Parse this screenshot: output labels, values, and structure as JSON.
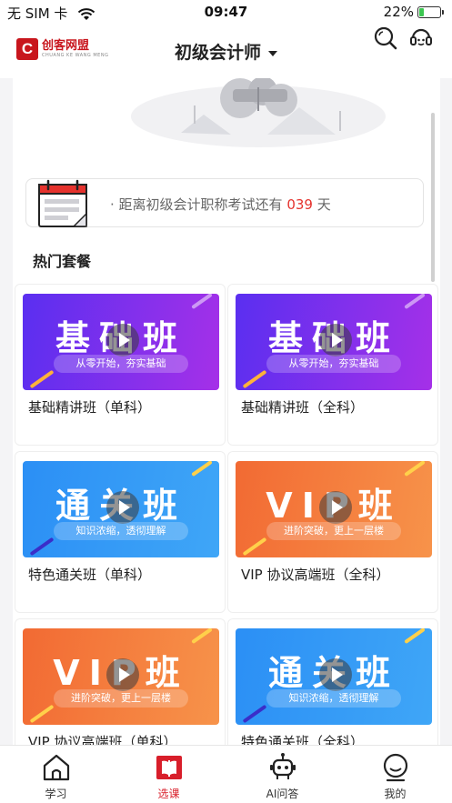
{
  "status_bar": {
    "carrier": "无 SIM 卡",
    "time": "09:47",
    "battery": "22%",
    "battery_level": 0.22
  },
  "header": {
    "logo_text": "创客网盟",
    "logo_sub": "CHUANG KE WANG MENG",
    "exam_title": "初级会计师",
    "icons": [
      "search-icon",
      "customer-service-icon"
    ]
  },
  "countdown": {
    "prefix": "· 距离初级会计职称考试还有",
    "days": "039",
    "suffix": "天"
  },
  "section": {
    "title": "热门套餐"
  },
  "courses": [
    {
      "title": "基础精讲班（单科）",
      "thumb_main": "基础班",
      "thumb_sub": "从零开始，夯实基础",
      "style": "purple"
    },
    {
      "title": "基础精讲班（全科）",
      "thumb_main": "基础班",
      "thumb_sub": "从零开始，夯实基础",
      "style": "purple"
    },
    {
      "title": "特色通关班（单科）",
      "thumb_main": "通关班",
      "thumb_sub": "知识浓缩，透彻理解",
      "style": "blue"
    },
    {
      "title": "VIP 协议高端班（全科）",
      "thumb_main": "VIP班",
      "thumb_sub": "进阶突破，更上一层楼",
      "style": "orange"
    },
    {
      "title": "VIP 协议高端班（单科）",
      "thumb_main": "VIP班",
      "thumb_sub": "进阶突破，更上一层楼",
      "style": "orange"
    },
    {
      "title": "特色通关班（全科）",
      "thumb_main": "通关班",
      "thumb_sub": "知识浓缩，透彻理解",
      "style": "blue"
    }
  ],
  "colors": {
    "accent_red": "#d81e2a",
    "purple_start": "#5a2ff0",
    "purple_end": "#a530e8",
    "blue_start": "#2b8ff5",
    "blue_end": "#3fa6f7",
    "orange_start": "#f26a33",
    "orange_end": "#f7934a"
  },
  "tabs": [
    {
      "label": "学习",
      "icon": "home-icon",
      "active": false
    },
    {
      "label": "选课",
      "icon": "book-icon",
      "active": true
    },
    {
      "label": "AI问答",
      "icon": "robot-icon",
      "active": false
    },
    {
      "label": "我的",
      "icon": "profile-icon",
      "active": false
    }
  ]
}
